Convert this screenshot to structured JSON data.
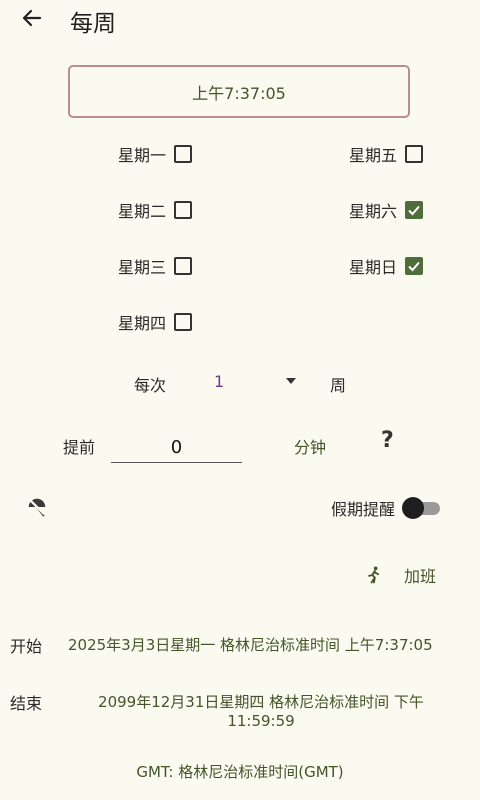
{
  "header": {
    "title": "每周"
  },
  "time": "上午7:37:05",
  "days": [
    {
      "label": "星期一",
      "checked": false
    },
    {
      "label": "星期二",
      "checked": false
    },
    {
      "label": "星期三",
      "checked": false
    },
    {
      "label": "星期四",
      "checked": false
    },
    {
      "label": "星期五",
      "checked": false
    },
    {
      "label": "星期六",
      "checked": true
    },
    {
      "label": "星期日",
      "checked": true
    }
  ],
  "repeat": {
    "label": "每次",
    "value": "1",
    "unit": "周"
  },
  "advance": {
    "label": "提前",
    "value": "0",
    "unit": "分钟",
    "help": "?"
  },
  "holiday": {
    "label": "假期提醒",
    "enabled": false
  },
  "overtime": {
    "label": "加班"
  },
  "start": {
    "label": "开始",
    "value": "2025年3月3日星期一 格林尼治标准时间 上午7:37:05"
  },
  "end": {
    "label": "结束",
    "value_line1": "2099年12月31日星期四 格林尼治标准时间 下午",
    "value_line2": "11:59:59"
  },
  "timezone": "GMT: 格林尼治标准时间(GMT)",
  "colors": {
    "accent": "#4F6D3B",
    "text_green": "#44552A",
    "border_pink": "#B98C91",
    "value_purple": "#6E3E8A"
  }
}
